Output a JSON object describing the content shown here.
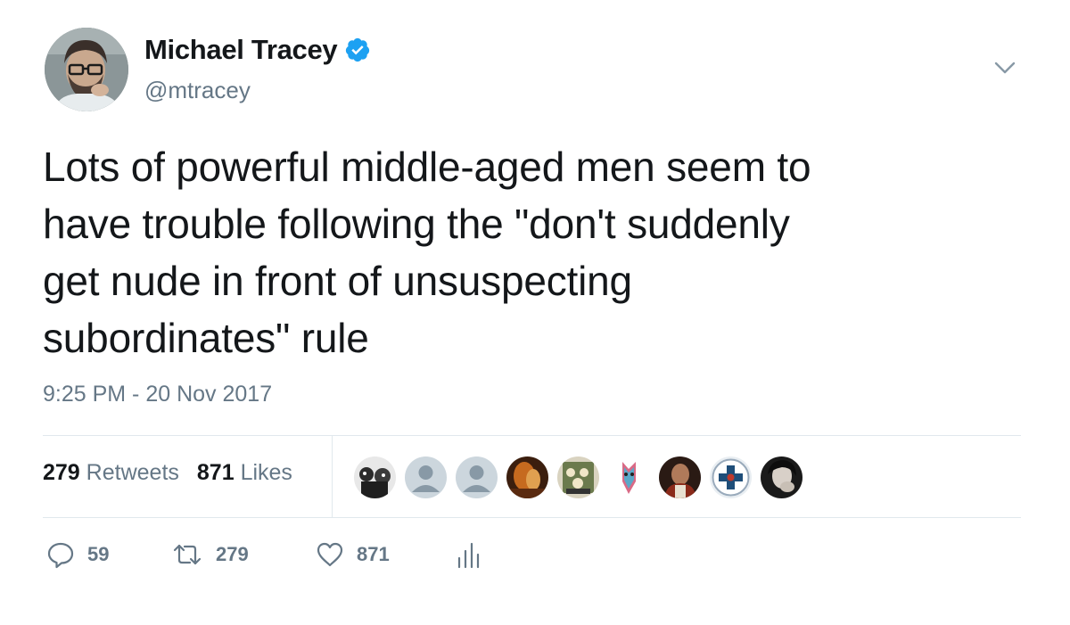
{
  "author": {
    "display_name": "Michael Tracey",
    "handle": "@mtracey",
    "verified": true
  },
  "tweet": {
    "text_lines": [
      "Lots of powerful middle-aged men seem to",
      "have trouble following the \"don't suddenly",
      "get nude in front of unsuspecting",
      "subordinates\" rule"
    ],
    "timestamp": "9:25 PM - 20 Nov 2017"
  },
  "stats": {
    "retweets_count": "279",
    "retweets_label": "Retweets",
    "likes_count": "871",
    "likes_label": "Likes"
  },
  "actions": {
    "replies": "59",
    "retweets": "279",
    "likes": "871"
  },
  "icons": {
    "verified": "verified-badge-icon",
    "menu": "chevron-down-icon",
    "reply": "reply-icon",
    "retweet": "retweet-icon",
    "like": "heart-icon",
    "analytics": "analytics-icon"
  },
  "colors": {
    "text": "#14171a",
    "secondary": "#657786",
    "verified": "#1da1f2",
    "divider": "#e1e8ed"
  }
}
